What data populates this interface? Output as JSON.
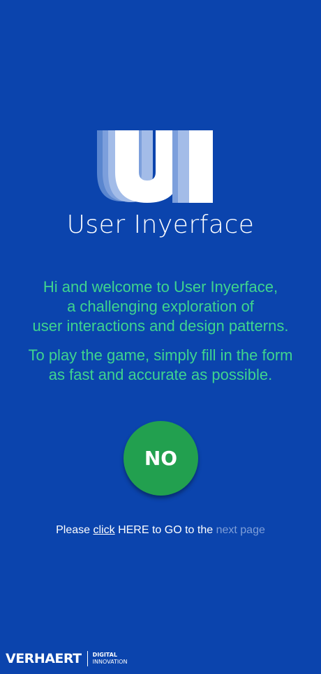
{
  "logo": {
    "icon": "ui-logo-icon",
    "text": "UI"
  },
  "app_title": "User Inyerface",
  "intro": {
    "welcome_lines": [
      "Hi and welcome to User Inyerface,",
      "a challenging exploration of",
      "user interactions and design patterns."
    ],
    "instruction_lines": [
      "To play the game, simply fill in the form",
      "as fast and accurate as possible."
    ]
  },
  "no_button": {
    "label": "NO"
  },
  "nav": {
    "please": "Please",
    "click": "click",
    "middle": "HERE to GO to the",
    "next_page": "next page"
  },
  "footer": {
    "brand": "VERHAERT",
    "tag_line1": "DIGITAL",
    "tag_line2": "INNOVATION"
  },
  "colors": {
    "background": "#0b44ad",
    "intro_text": "#3fd48e",
    "button": "#22a04f",
    "next_link": "#7f9fd8"
  }
}
